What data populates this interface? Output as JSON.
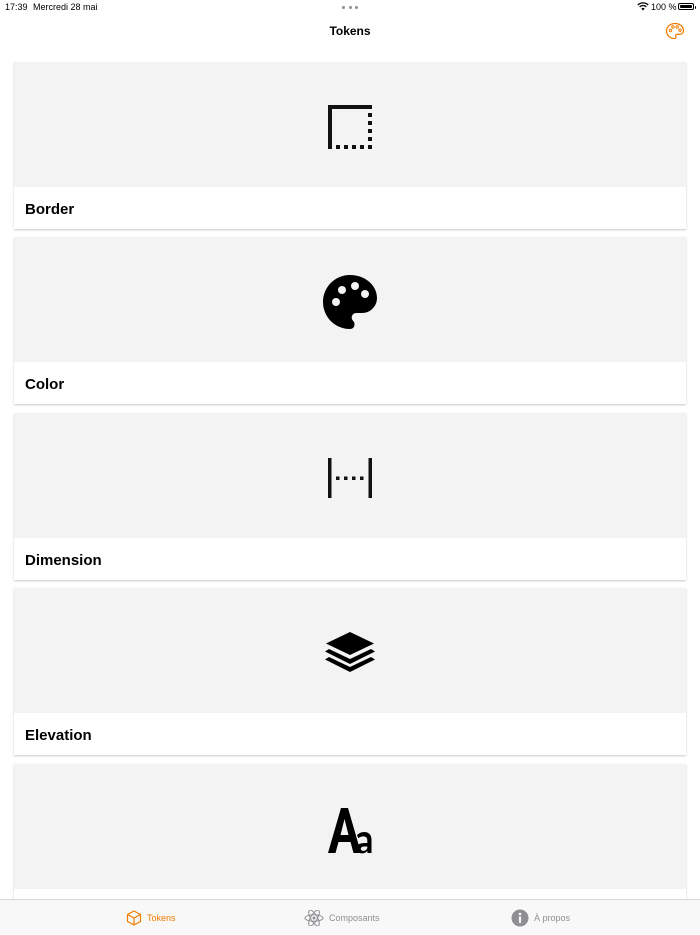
{
  "status_bar": {
    "time": "17:39",
    "date": "Mercredi 28 mai",
    "battery_percent": "100 %"
  },
  "nav": {
    "title": "Tokens",
    "right_icon": "palette-icon",
    "accent_color": "#f07c00"
  },
  "cards": [
    {
      "label": "Border",
      "icon": "border-icon"
    },
    {
      "label": "Color",
      "icon": "palette-icon"
    },
    {
      "label": "Dimension",
      "icon": "dimension-icon"
    },
    {
      "label": "Elevation",
      "icon": "layers-icon"
    },
    {
      "label": "",
      "icon": "typography-icon"
    }
  ],
  "tabs": [
    {
      "label": "Tokens",
      "icon": "cube-icon",
      "active": true
    },
    {
      "label": "Composants",
      "icon": "atom-icon",
      "active": false
    },
    {
      "label": "À propos",
      "icon": "info-icon",
      "active": false
    }
  ],
  "colors": {
    "accent": "#f07c00",
    "inactive": "#8e8e93",
    "card_media_bg": "#f3f3f3"
  }
}
